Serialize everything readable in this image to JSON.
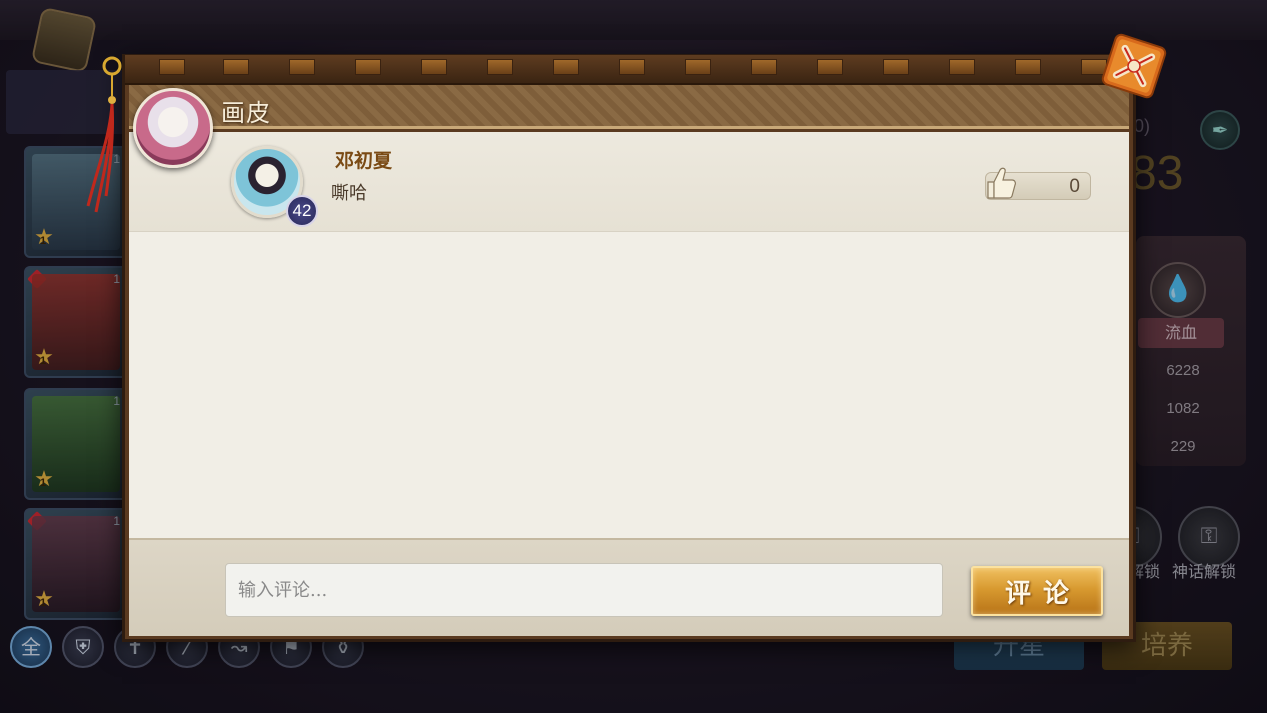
{
  "dialog": {
    "title": "画皮",
    "input_placeholder": "输入评论...",
    "submit_label": "评论"
  },
  "comments": [
    {
      "username": "邓初夏",
      "text": "嘶哈",
      "level": "42",
      "likes": "0"
    }
  ],
  "background": {
    "hero_levels": [
      "1",
      "1",
      "1",
      "1"
    ],
    "hero_stars": [
      "1",
      "1",
      "1",
      "1"
    ],
    "filter_all_label": "全",
    "small_num": "0)",
    "big_num": "83",
    "stat_header": "流血",
    "stat_values": [
      "6228",
      "1082",
      "229"
    ],
    "unlock_labels": [
      "解锁",
      "神话解锁"
    ],
    "btn_ascend": "升星",
    "btn_train": "培养"
  },
  "colors": {
    "dialog_frame": "#5a3a20",
    "title_bar": "#8a6a44",
    "content_bg": "#f1eee6",
    "submit_gold": "#d89a30",
    "username": "#7a4a14"
  }
}
